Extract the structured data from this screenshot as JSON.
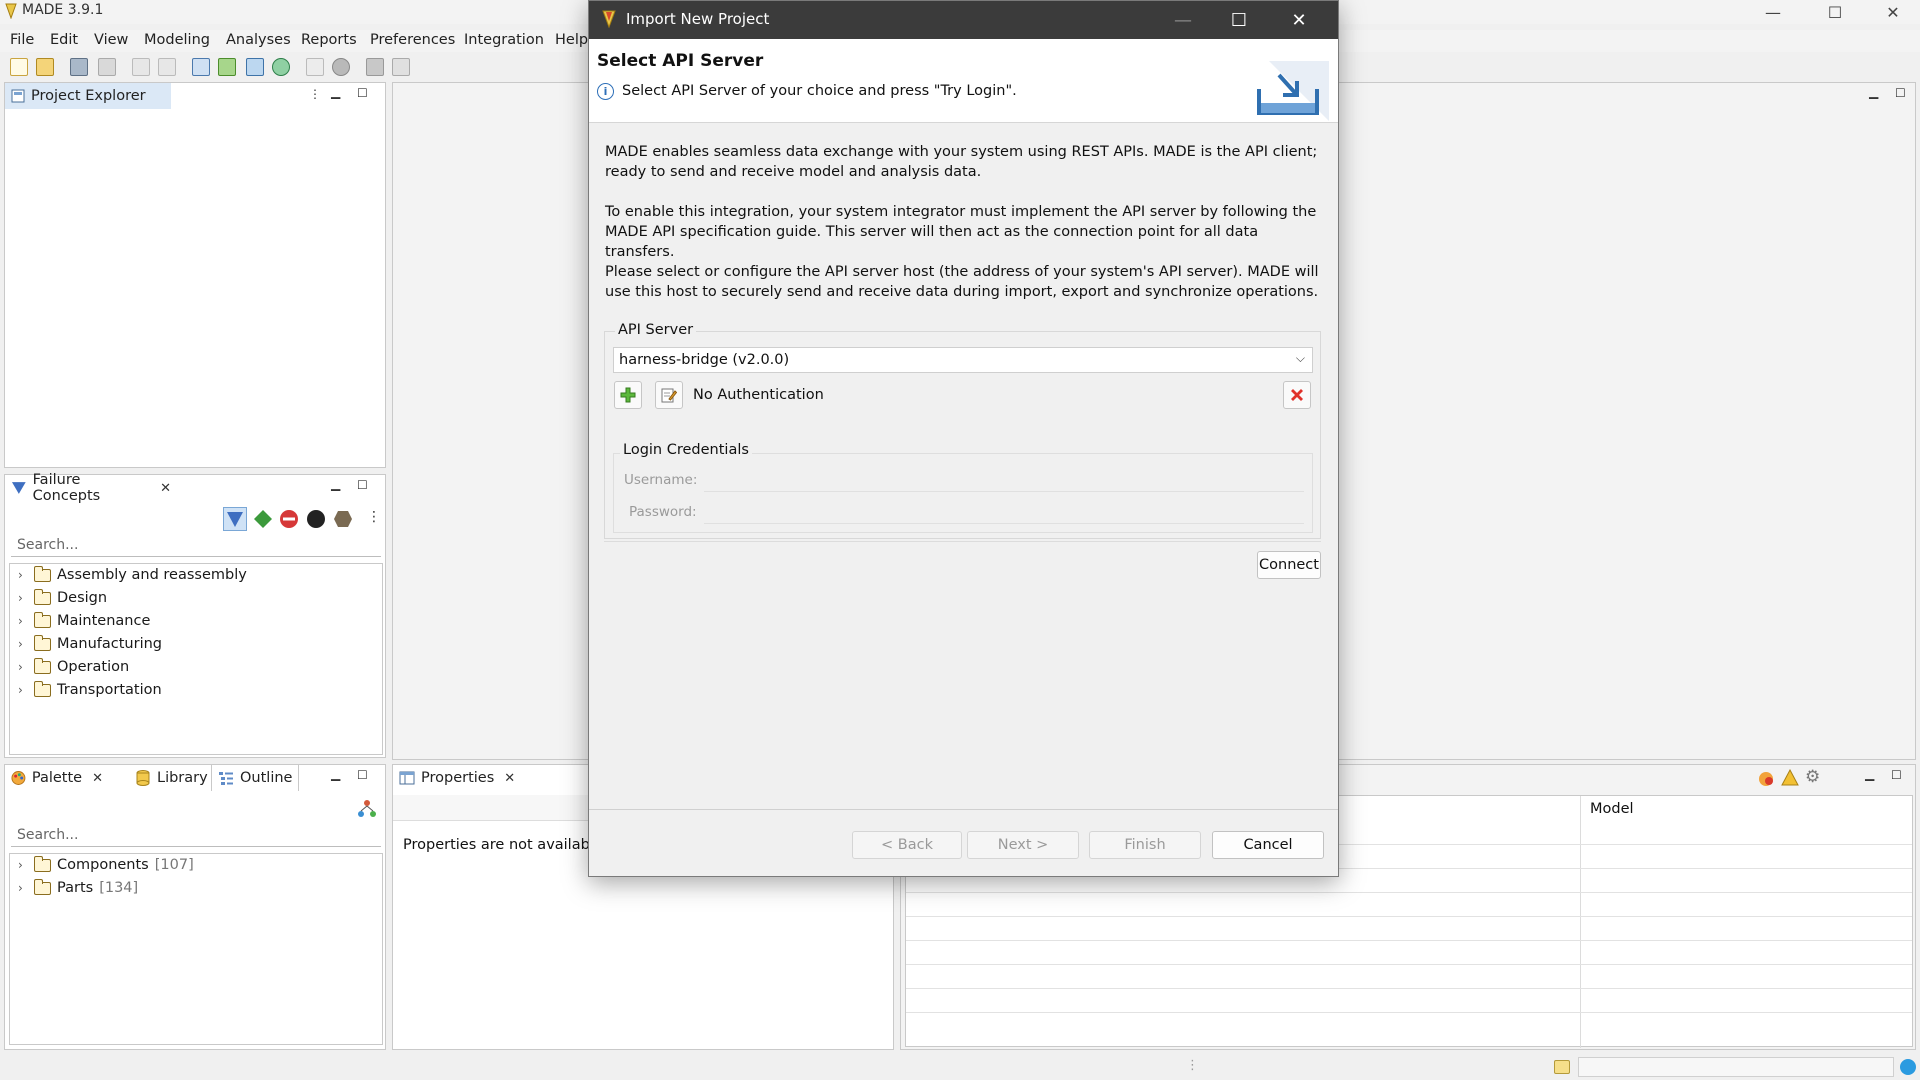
{
  "app": {
    "title": "MADE 3.9.1",
    "menu": [
      "File",
      "Edit",
      "View",
      "Modeling",
      "Analyses",
      "Reports",
      "Preferences",
      "Integration",
      "Help"
    ],
    "window_controls": {
      "minimize": "—",
      "maximize": "☐",
      "close": "✕"
    }
  },
  "project_explorer": {
    "tab_label": "Project Explorer"
  },
  "failure_concepts": {
    "tab_label": "Failure Concepts",
    "search_placeholder": "Search...",
    "items": [
      "Assembly and reassembly",
      "Design",
      "Maintenance",
      "Manufacturing",
      "Operation",
      "Transportation"
    ]
  },
  "palette": {
    "tabs": [
      "Palette",
      "Library",
      "Outline"
    ],
    "search_placeholder": "Search...",
    "items": [
      {
        "label": "Components",
        "count": "[107]"
      },
      {
        "label": "Parts",
        "count": "[134]"
      }
    ]
  },
  "properties": {
    "tab_label": "Properties",
    "message": "Properties are not available"
  },
  "results_table": {
    "column_header": "Model"
  },
  "dialog": {
    "title": "Import New Project",
    "heading": "Select API Server",
    "subtitle": "Select API Server of your choice and press \"Try Login\".",
    "paragraphs": [
      "MADE enables seamless data exchange with your system using REST APIs. MADE is the API client; ready to send and receive model and analysis data.",
      "To enable this integration, your system integrator must implement the API server by following the MADE API specification guide. This server will then act as the connection point for all data transfers.",
      "Please select or configure the API server host (the address of your system's API server). MADE will use this host to securely send and receive data during import, export and synchronize operations."
    ],
    "api_server_group_label": "API Server",
    "api_server_selected": "harness-bridge (v2.0.0)",
    "auth_label": "No Authentication",
    "credentials_group_label": "Login Credentials",
    "username_label": "Username:",
    "password_label": "Password:",
    "connect_button": "Connect",
    "back_button": "< Back",
    "next_button": "Next >",
    "finish_button": "Finish",
    "cancel_button": "Cancel",
    "window_controls": {
      "minimize": "—",
      "maximize": "☐",
      "close": "✕"
    }
  }
}
